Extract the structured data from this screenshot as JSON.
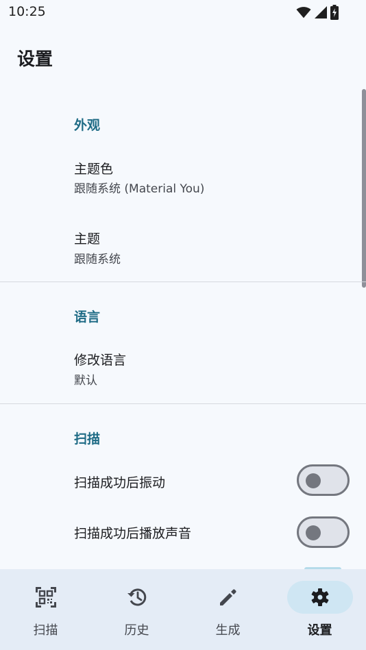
{
  "status_bar": {
    "time": "10:25",
    "icons": [
      "wifi-icon",
      "signal-icon",
      "battery-charging-icon"
    ]
  },
  "page": {
    "title": "设置"
  },
  "sections": {
    "appearance": {
      "header": "外观",
      "theme_color": {
        "title": "主题色",
        "summary": "跟随系统 (Material You)"
      },
      "theme": {
        "title": "主题",
        "summary": "跟随系统"
      }
    },
    "language": {
      "header": "语言",
      "change_language": {
        "title": "修改语言",
        "summary": "默认"
      }
    },
    "scan": {
      "header": "扫描",
      "vibrate": {
        "title": "扫描成功后振动",
        "enabled": false
      },
      "sound": {
        "title": "扫描成功后播放声音",
        "enabled": false
      }
    }
  },
  "bottom_nav": {
    "items": [
      {
        "label": "扫描",
        "icon": "qr-code-scan-icon",
        "active": false
      },
      {
        "label": "历史",
        "icon": "history-icon",
        "active": false
      },
      {
        "label": "生成",
        "icon": "pencil-icon",
        "active": false
      },
      {
        "label": "设置",
        "icon": "gear-icon",
        "active": true
      }
    ]
  },
  "colors": {
    "accent": "#1e6b85",
    "background": "#f6f9fd",
    "nav_background": "#e4ecf6",
    "nav_active_pill": "#cfe6f3"
  }
}
